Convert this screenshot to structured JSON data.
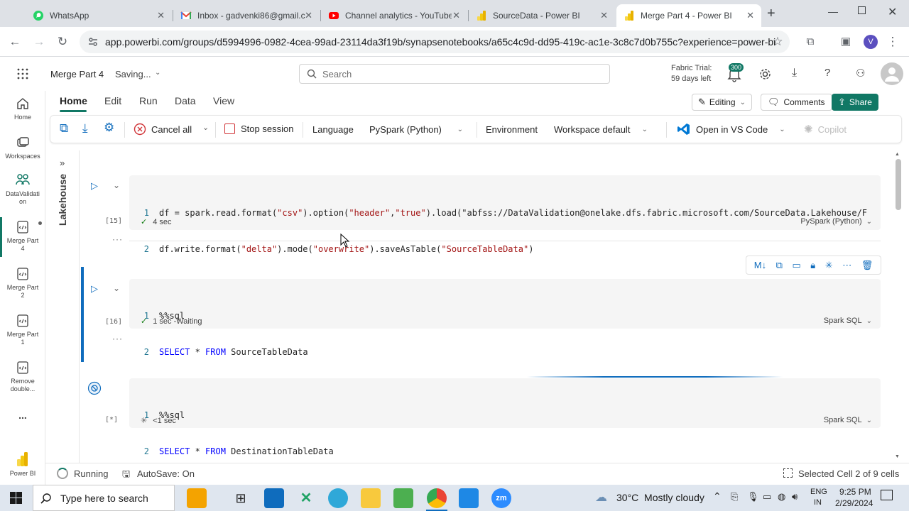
{
  "browser": {
    "tabs": [
      {
        "label": "WhatsApp",
        "icon": "whatsapp-icon"
      },
      {
        "label": "Inbox - gadvenki86@gmail.c",
        "icon": "gmail-icon"
      },
      {
        "label": "Channel analytics - YouTube",
        "icon": "youtube-icon"
      },
      {
        "label": "SourceData - Power BI",
        "icon": "powerbi-icon"
      },
      {
        "label": "Merge Part 4 - Power BI",
        "icon": "powerbi-icon"
      }
    ],
    "url": "app.powerbi.com/groups/d5994996-0982-4cea-99ad-23114da3f19b/synapsenotebooks/a65c4c9d-dd95-419c-ac1e-3c8c7d0b755c?experience=power-bi",
    "profile_initial": "V"
  },
  "app": {
    "notebook_title": "Merge Part 4",
    "save_state": "Saving...",
    "search_placeholder": "Search",
    "trial_line1": "Fabric Trial:",
    "trial_line2": "59 days left",
    "notif_count": "300"
  },
  "ribbon": {
    "tabs": [
      "Home",
      "Edit",
      "Run",
      "Data",
      "View"
    ],
    "active_tab": "Home",
    "editing": "Editing",
    "comments": "Comments",
    "share": "Share",
    "cancel_all": "Cancel all",
    "stop_session": "Stop session",
    "language_label": "Language",
    "language_value": "PySpark (Python)",
    "environment_label": "Environment",
    "environment_value": "Workspace default",
    "open_vscode": "Open in VS Code",
    "copilot": "Copilot"
  },
  "leftnav": {
    "home": "Home",
    "workspaces": "Workspaces",
    "datavalidation": "DataValidati on",
    "merge4": "Merge Part 4",
    "merge2": "Merge Part 2",
    "merge1": "Merge Part 1",
    "remove": "Remove double...",
    "more": "...",
    "powerbi": "Power BI"
  },
  "lakehouse_label": "Lakehouse",
  "cells": [
    {
      "exec_count": "[15]",
      "lines": [
        {
          "n": "1",
          "text": "df = spark.read.format(\"csv\").option(\"header\",\"true\").load(\"abfss://DataValidation@onelake.dfs.fabric.microsoft.com/SourceData.Lakehouse/F"
        },
        {
          "n": "2",
          "text": "df.write.format(\"delta\").mode(\"overwrite\").saveAsTable(\"SourceTableData\")"
        }
      ],
      "status": "4 sec",
      "lang": "PySpark (Python)"
    },
    {
      "exec_count": "[16]",
      "lines": [
        {
          "n": "1",
          "text": "%%sql"
        },
        {
          "n": "2",
          "text": "SELECT * FROM SourceTableData"
        }
      ],
      "status": "1 sec -Waiting",
      "lang": "Spark SQL"
    },
    {
      "exec_count": "[*]",
      "lines": [
        {
          "n": "1",
          "text": "%%sql"
        },
        {
          "n": "2",
          "text": "SELECT * FROM DestinationTableData"
        }
      ],
      "status": "<1 sec",
      "lang": "Spark SQL"
    }
  ],
  "cell_toolbar_md": "M↓",
  "ellipsis": "···",
  "status": {
    "running": "Running",
    "autosave": "AutoSave: On",
    "selected": "Selected Cell 2 of 9 cells"
  },
  "taskbar": {
    "search": "Type here to search",
    "weather": "30°C  Mostly cloudy",
    "lang1": "ENG",
    "lang2": "IN",
    "time": "9:25 PM",
    "date": "2/29/2024"
  },
  "colors": {
    "accent": "#117865",
    "selected_cell_bar": "#0f6cbd"
  }
}
